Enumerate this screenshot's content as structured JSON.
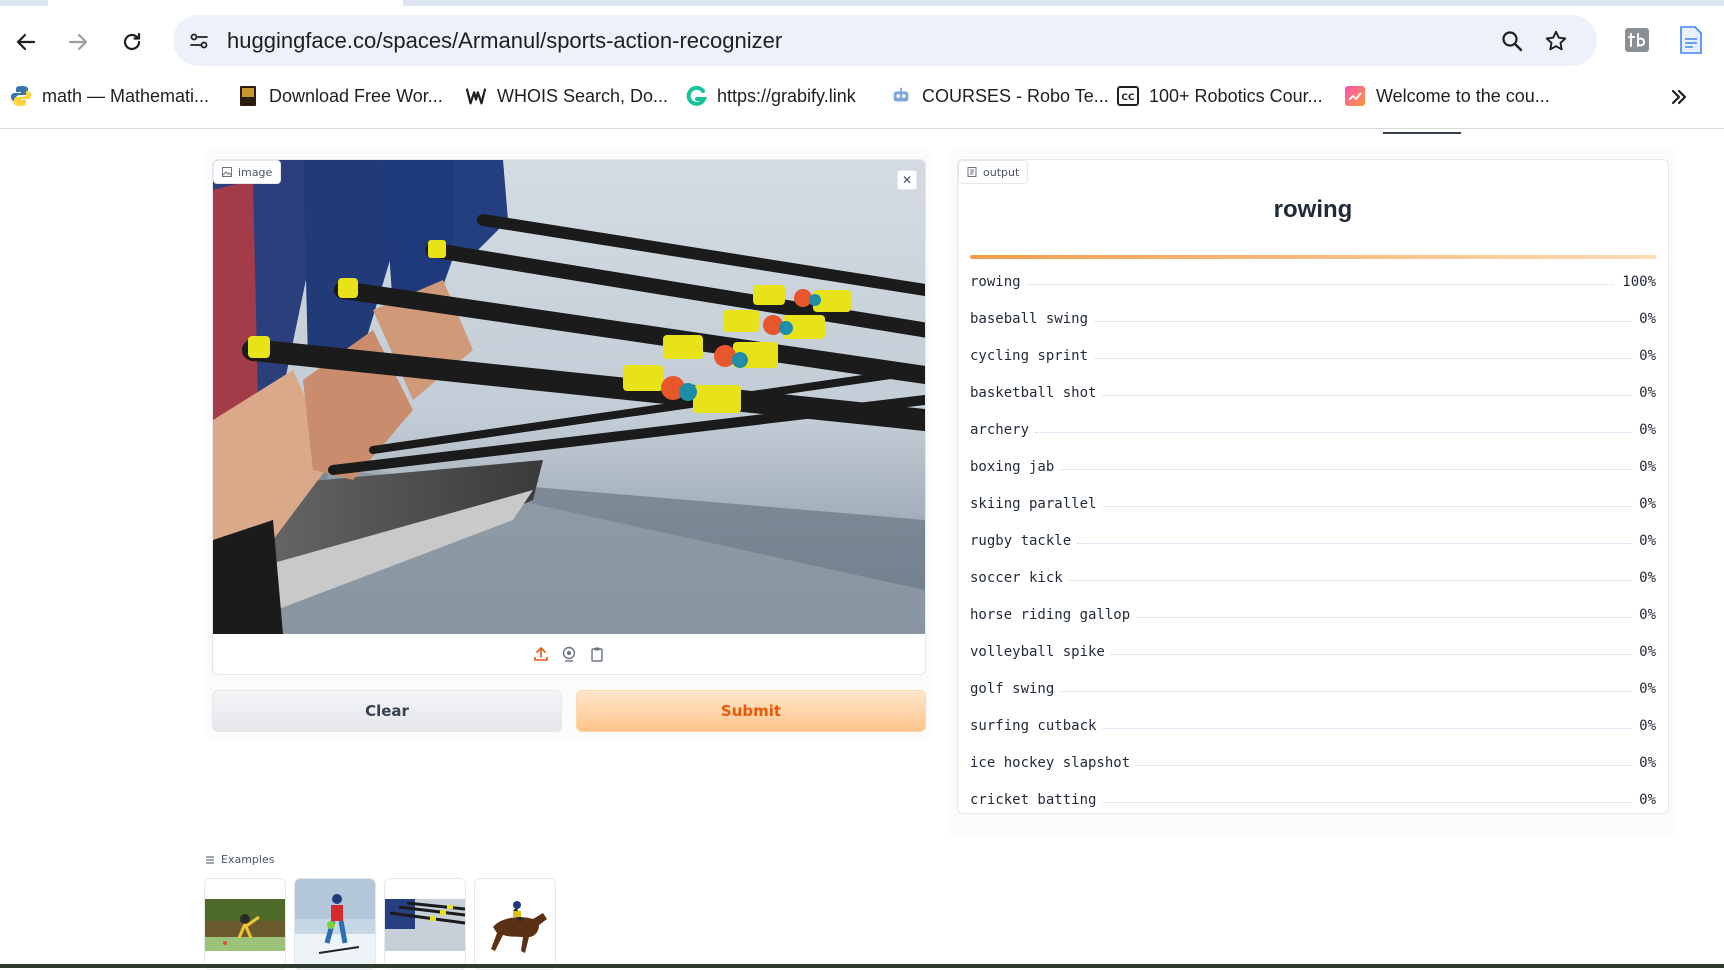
{
  "browser": {
    "url": "huggingface.co/spaces/Armanul/sports-action-recognizer",
    "bookmarks": [
      {
        "label": "math — Mathemati...",
        "icon": "python-icon"
      },
      {
        "label": "Download Free Wor...",
        "icon": "book-icon"
      },
      {
        "label": "WHOIS Search, Do...",
        "icon": "whois-icon"
      },
      {
        "label": "https://grabify.link",
        "icon": "grabify-icon"
      },
      {
        "label": "COURSES - Robo Te...",
        "icon": "robot-icon"
      },
      {
        "label": "100+ Robotics Cour...",
        "icon": "cc-icon"
      },
      {
        "label": "Welcome to the cou...",
        "icon": "welcome-icon"
      }
    ]
  },
  "input_panel": {
    "chip_label": "image",
    "clear_label": "Clear",
    "submit_label": "Submit"
  },
  "output_panel": {
    "chip_label": "output",
    "top_label": "rowing",
    "top_fraction": 1.0,
    "confidences": [
      {
        "label": "rowing",
        "value": "100%"
      },
      {
        "label": "baseball swing",
        "value": "0%"
      },
      {
        "label": "cycling sprint",
        "value": "0%"
      },
      {
        "label": "basketball shot",
        "value": "0%"
      },
      {
        "label": "archery",
        "value": "0%"
      },
      {
        "label": "boxing jab",
        "value": "0%"
      },
      {
        "label": "skiing parallel",
        "value": "0%"
      },
      {
        "label": "rugby tackle",
        "value": "0%"
      },
      {
        "label": "soccer kick",
        "value": "0%"
      },
      {
        "label": "horse riding gallop",
        "value": "0%"
      },
      {
        "label": "volleyball spike",
        "value": "0%"
      },
      {
        "label": "golf swing",
        "value": "0%"
      },
      {
        "label": "surfing cutback",
        "value": "0%"
      },
      {
        "label": "ice hockey slapshot",
        "value": "0%"
      },
      {
        "label": "cricket batting",
        "value": "0%"
      }
    ]
  },
  "examples": {
    "label": "Examples"
  },
  "colors": {
    "accent": "#ea580c",
    "submit_bg": "#fdc48a",
    "bar": "#f39c4a"
  }
}
